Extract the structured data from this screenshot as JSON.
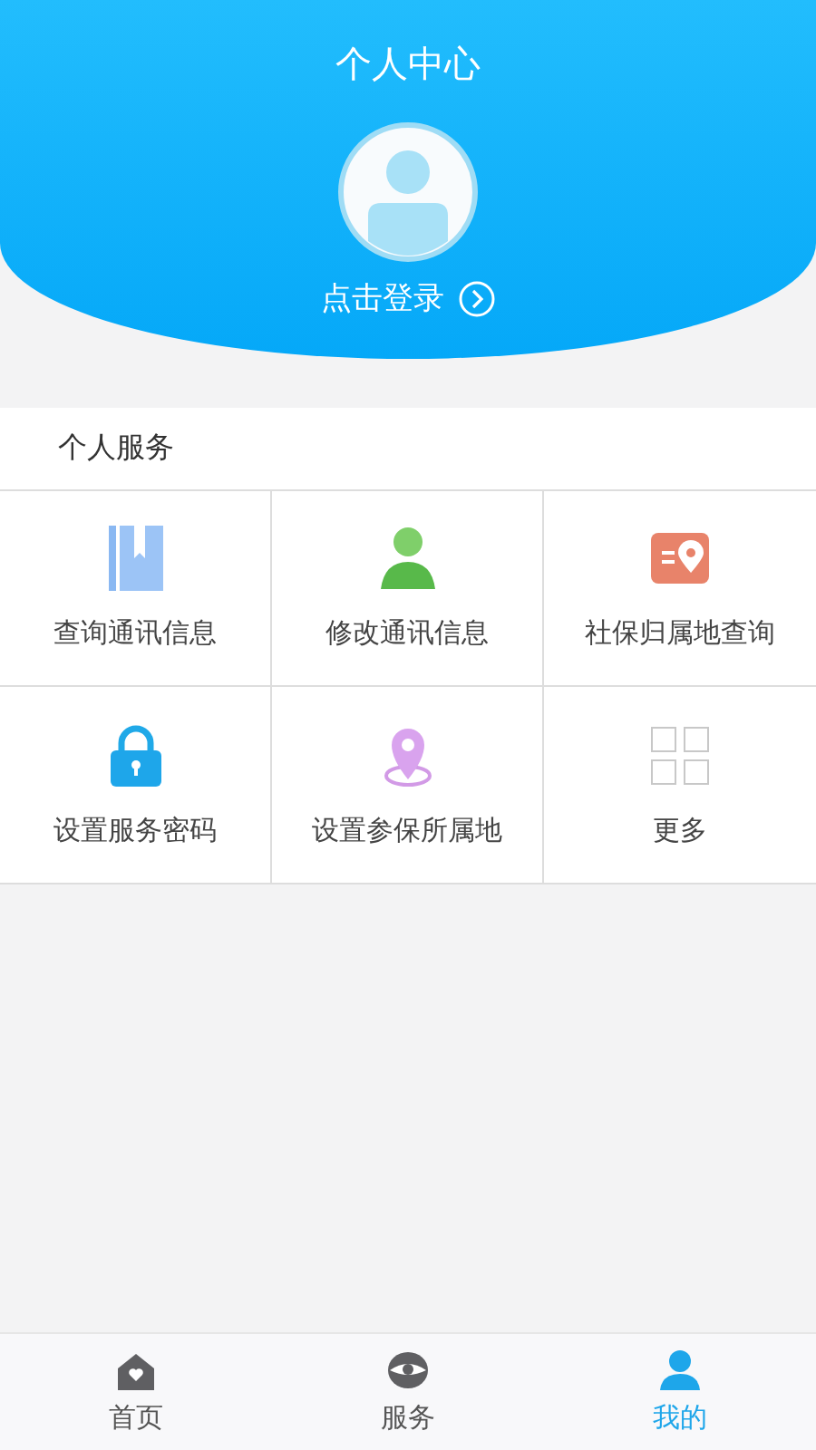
{
  "header": {
    "title": "个人中心",
    "login_label": "点击登录"
  },
  "section": {
    "title": "个人服务"
  },
  "services": [
    {
      "kind": "book",
      "label": "查询通讯信息"
    },
    {
      "kind": "person",
      "label": "修改通讯信息"
    },
    {
      "kind": "location-card",
      "label": "社保归属地查询"
    },
    {
      "kind": "lock",
      "label": "设置服务密码"
    },
    {
      "kind": "pin",
      "label": "设置参保所属地"
    },
    {
      "kind": "more",
      "label": "更多"
    }
  ],
  "tabs": [
    {
      "kind": "home",
      "label": "首页",
      "selected": false
    },
    {
      "kind": "eye",
      "label": "服务",
      "selected": false
    },
    {
      "kind": "user",
      "label": "我的",
      "selected": true
    }
  ]
}
